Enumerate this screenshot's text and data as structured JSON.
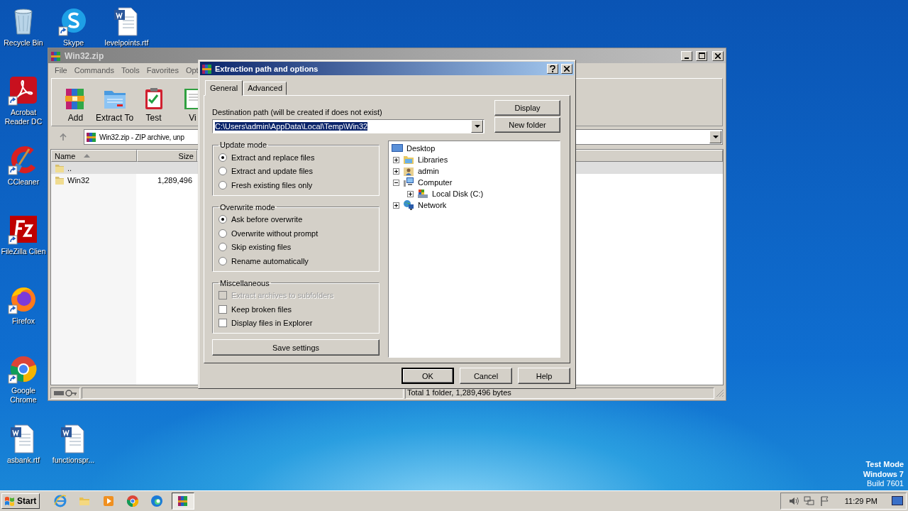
{
  "desktop_icons": [
    {
      "label": "Recycle Bin",
      "kind": "bin",
      "shortcut": false
    },
    {
      "label": "Skype",
      "kind": "skype",
      "shortcut": true
    },
    {
      "label": "levelpoints.rtf",
      "kind": "doc",
      "shortcut": false
    },
    {
      "label": "Acrobat Reader DC",
      "kind": "acrobat",
      "shortcut": true
    },
    {
      "label": "CCleaner",
      "kind": "ccleaner",
      "shortcut": true
    },
    {
      "label": "FileZilla Clien",
      "kind": "filezilla",
      "shortcut": true
    },
    {
      "label": "Firefox",
      "kind": "firefox",
      "shortcut": true
    },
    {
      "label": "Google Chrome",
      "kind": "chrome",
      "shortcut": true
    },
    {
      "label": "asbank.rtf",
      "kind": "doc",
      "shortcut": false
    },
    {
      "label": "functionspr...",
      "kind": "doc",
      "shortcut": false
    }
  ],
  "archive_window": {
    "title": "Win32.zip",
    "menu": [
      "File",
      "Commands",
      "Tools",
      "Favorites",
      "Opt"
    ],
    "toolbar": [
      {
        "label": "Add",
        "kind": "add"
      },
      {
        "label": "Extract To",
        "kind": "extract"
      },
      {
        "label": "Test",
        "kind": "test"
      },
      {
        "label": "Vi",
        "kind": "view"
      }
    ],
    "address": "Win32.zip - ZIP archive, unp",
    "columns": [
      "Name",
      "Size"
    ],
    "rows": [
      {
        "name": "..",
        "selected": true
      },
      {
        "name": "Win32",
        "size": "1,289,496",
        "selected": false
      }
    ],
    "status": "Total 1 folder, 1,289,496 bytes"
  },
  "dialog": {
    "title": "Extraction path and options",
    "tabs": [
      {
        "label": "General",
        "selected": true
      },
      {
        "label": "Advanced",
        "selected": false
      }
    ],
    "path_label": "Destination path (will be created if does not exist)",
    "path": {
      "value": "C:\\Users\\admin\\AppData\\Local\\Temp\\Win32",
      "highlighted": true
    },
    "side_buttons": [
      "Display",
      "New folder"
    ],
    "groups": [
      {
        "title": "Update mode",
        "kind": "radio",
        "options": [
          {
            "label": "Extract and replace files",
            "selected": true
          },
          {
            "label": "Extract and update files",
            "selected": false
          },
          {
            "label": "Fresh existing files only",
            "selected": false
          }
        ]
      },
      {
        "title": "Overwrite mode",
        "kind": "radio",
        "options": [
          {
            "label": "Ask before overwrite",
            "selected": true
          },
          {
            "label": "Overwrite without prompt",
            "selected": false
          },
          {
            "label": "Skip existing files",
            "selected": false
          },
          {
            "label": "Rename automatically",
            "selected": false
          }
        ]
      },
      {
        "title": "Miscellaneous",
        "kind": "check",
        "options": [
          {
            "label": "Extract archives to subfolders",
            "checked": false,
            "disabled": true
          },
          {
            "label": "Keep broken files",
            "checked": false,
            "disabled": false
          },
          {
            "label": "Display files in Explorer",
            "checked": false,
            "disabled": false
          }
        ]
      }
    ],
    "save_button": "Save settings",
    "tree": [
      {
        "label": "Desktop",
        "kind": "desktop",
        "children": [
          {
            "label": "Libraries",
            "kind": "libraries",
            "expanded": false
          },
          {
            "label": "admin",
            "kind": "user",
            "expanded": false
          },
          {
            "label": "Computer",
            "kind": "computer",
            "expanded": true,
            "children": [
              {
                "label": "Local Disk (C:)",
                "kind": "disk",
                "expanded": false
              }
            ]
          },
          {
            "label": "Network",
            "kind": "network",
            "expanded": false
          }
        ]
      }
    ],
    "buttons": [
      {
        "label": "OK",
        "default": true
      },
      {
        "label": "Cancel",
        "default": false
      },
      {
        "label": "Help",
        "default": false
      }
    ]
  },
  "taskbar": {
    "start": "Start",
    "apps": [
      {
        "kind": "ie",
        "active": false
      },
      {
        "kind": "explorer",
        "active": false
      },
      {
        "kind": "media",
        "active": false
      },
      {
        "kind": "chrome",
        "active": false
      },
      {
        "kind": "edge",
        "active": false
      },
      {
        "kind": "winrar",
        "active": true
      }
    ],
    "clock": "11:29 PM"
  },
  "os_notice": [
    "Test Mode",
    "Windows 7",
    "Build 7601"
  ]
}
